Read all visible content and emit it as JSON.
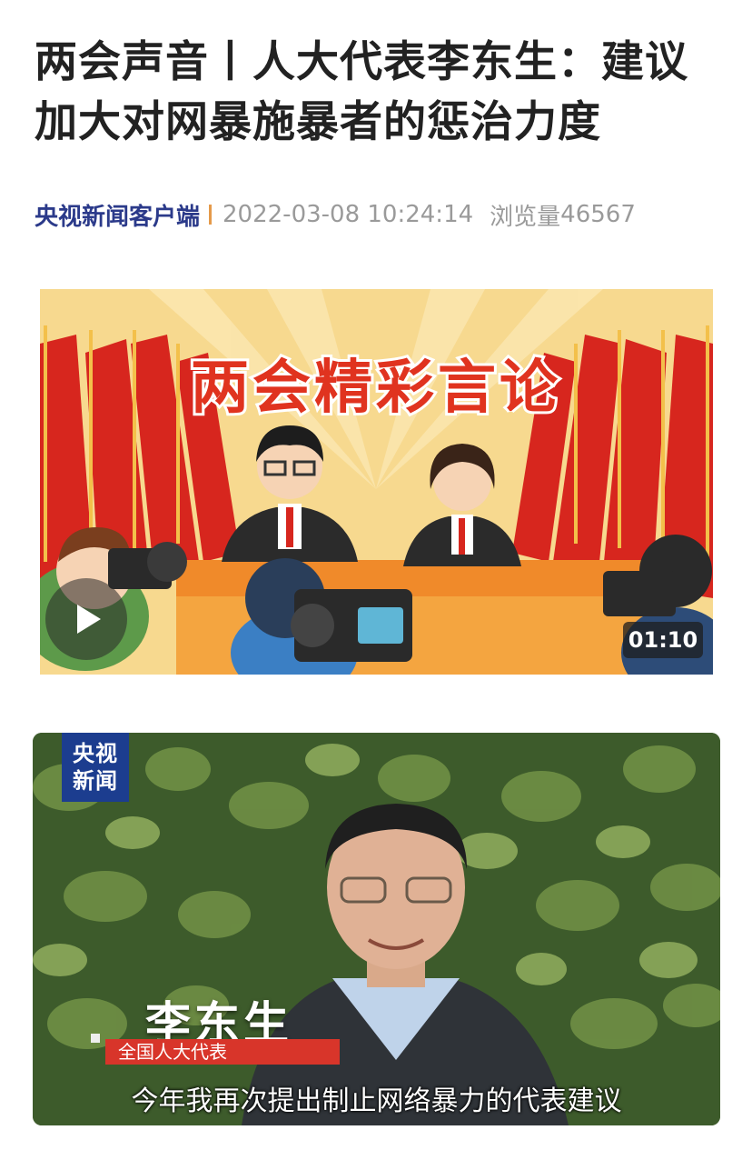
{
  "article": {
    "title": "两会声音丨人大代表李东生：建议加大对网暴施暴者的惩治力度",
    "source": "央视新闻客户端",
    "datetime": "2022-03-08 10:24:14",
    "views_label": "浏览量",
    "views": "46567"
  },
  "video": {
    "banner_text": "两会精彩言论",
    "duration": "01:10",
    "play_icon": "play-icon"
  },
  "photo": {
    "logo_line1": "央视",
    "logo_line2": "新闻",
    "name_caption": "李东生",
    "role_caption": "全国人大代表",
    "subtitle": "今年我再次提出制止网络暴力的代表建议"
  },
  "colors": {
    "source_blue": "#2b3a8a",
    "divider_orange": "#e59a4a",
    "meta_gray": "#9a9a9a",
    "flag_red": "#d7261e",
    "caption_red": "#d8352a"
  }
}
